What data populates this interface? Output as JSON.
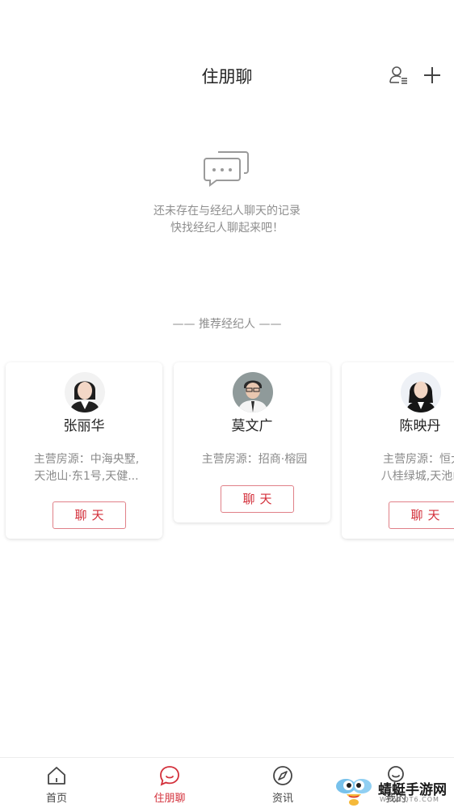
{
  "header": {
    "title": "住朋聊"
  },
  "empty_state": {
    "line1": "还未存在与经纪人聊天的记录",
    "line2": "快找经纪人聊起来吧！"
  },
  "recommend": {
    "header": "—— 推荐经纪人 ——"
  },
  "agents": [
    {
      "name": "张丽华",
      "specialty_line1": "主营房源：中海央墅,",
      "specialty_line2": "天池山·东1号,天健...",
      "chat_label": "聊天"
    },
    {
      "name": "莫文广",
      "specialty_line1": "主营房源：招商·榕园",
      "specialty_line2": "",
      "chat_label": "聊天"
    },
    {
      "name": "陈映丹",
      "specialty_line1": "主营房源：恒大",
      "specialty_line2": "八桂绿城,天池山",
      "chat_label": "聊天"
    }
  ],
  "bottom_nav": [
    {
      "label": "首页",
      "icon": "home-icon",
      "active": false
    },
    {
      "label": "住朋聊",
      "icon": "chat-bubble-icon",
      "active": true
    },
    {
      "label": "资讯",
      "icon": "compass-icon",
      "active": false
    },
    {
      "label": "我的",
      "icon": "profile-icon",
      "active": false
    }
  ],
  "watermark": {
    "text": "蜻蜓手游网",
    "sub": "WWW.QT6.COM"
  },
  "colors": {
    "accent": "#d32f3a",
    "muted": "#8e8e8e"
  }
}
